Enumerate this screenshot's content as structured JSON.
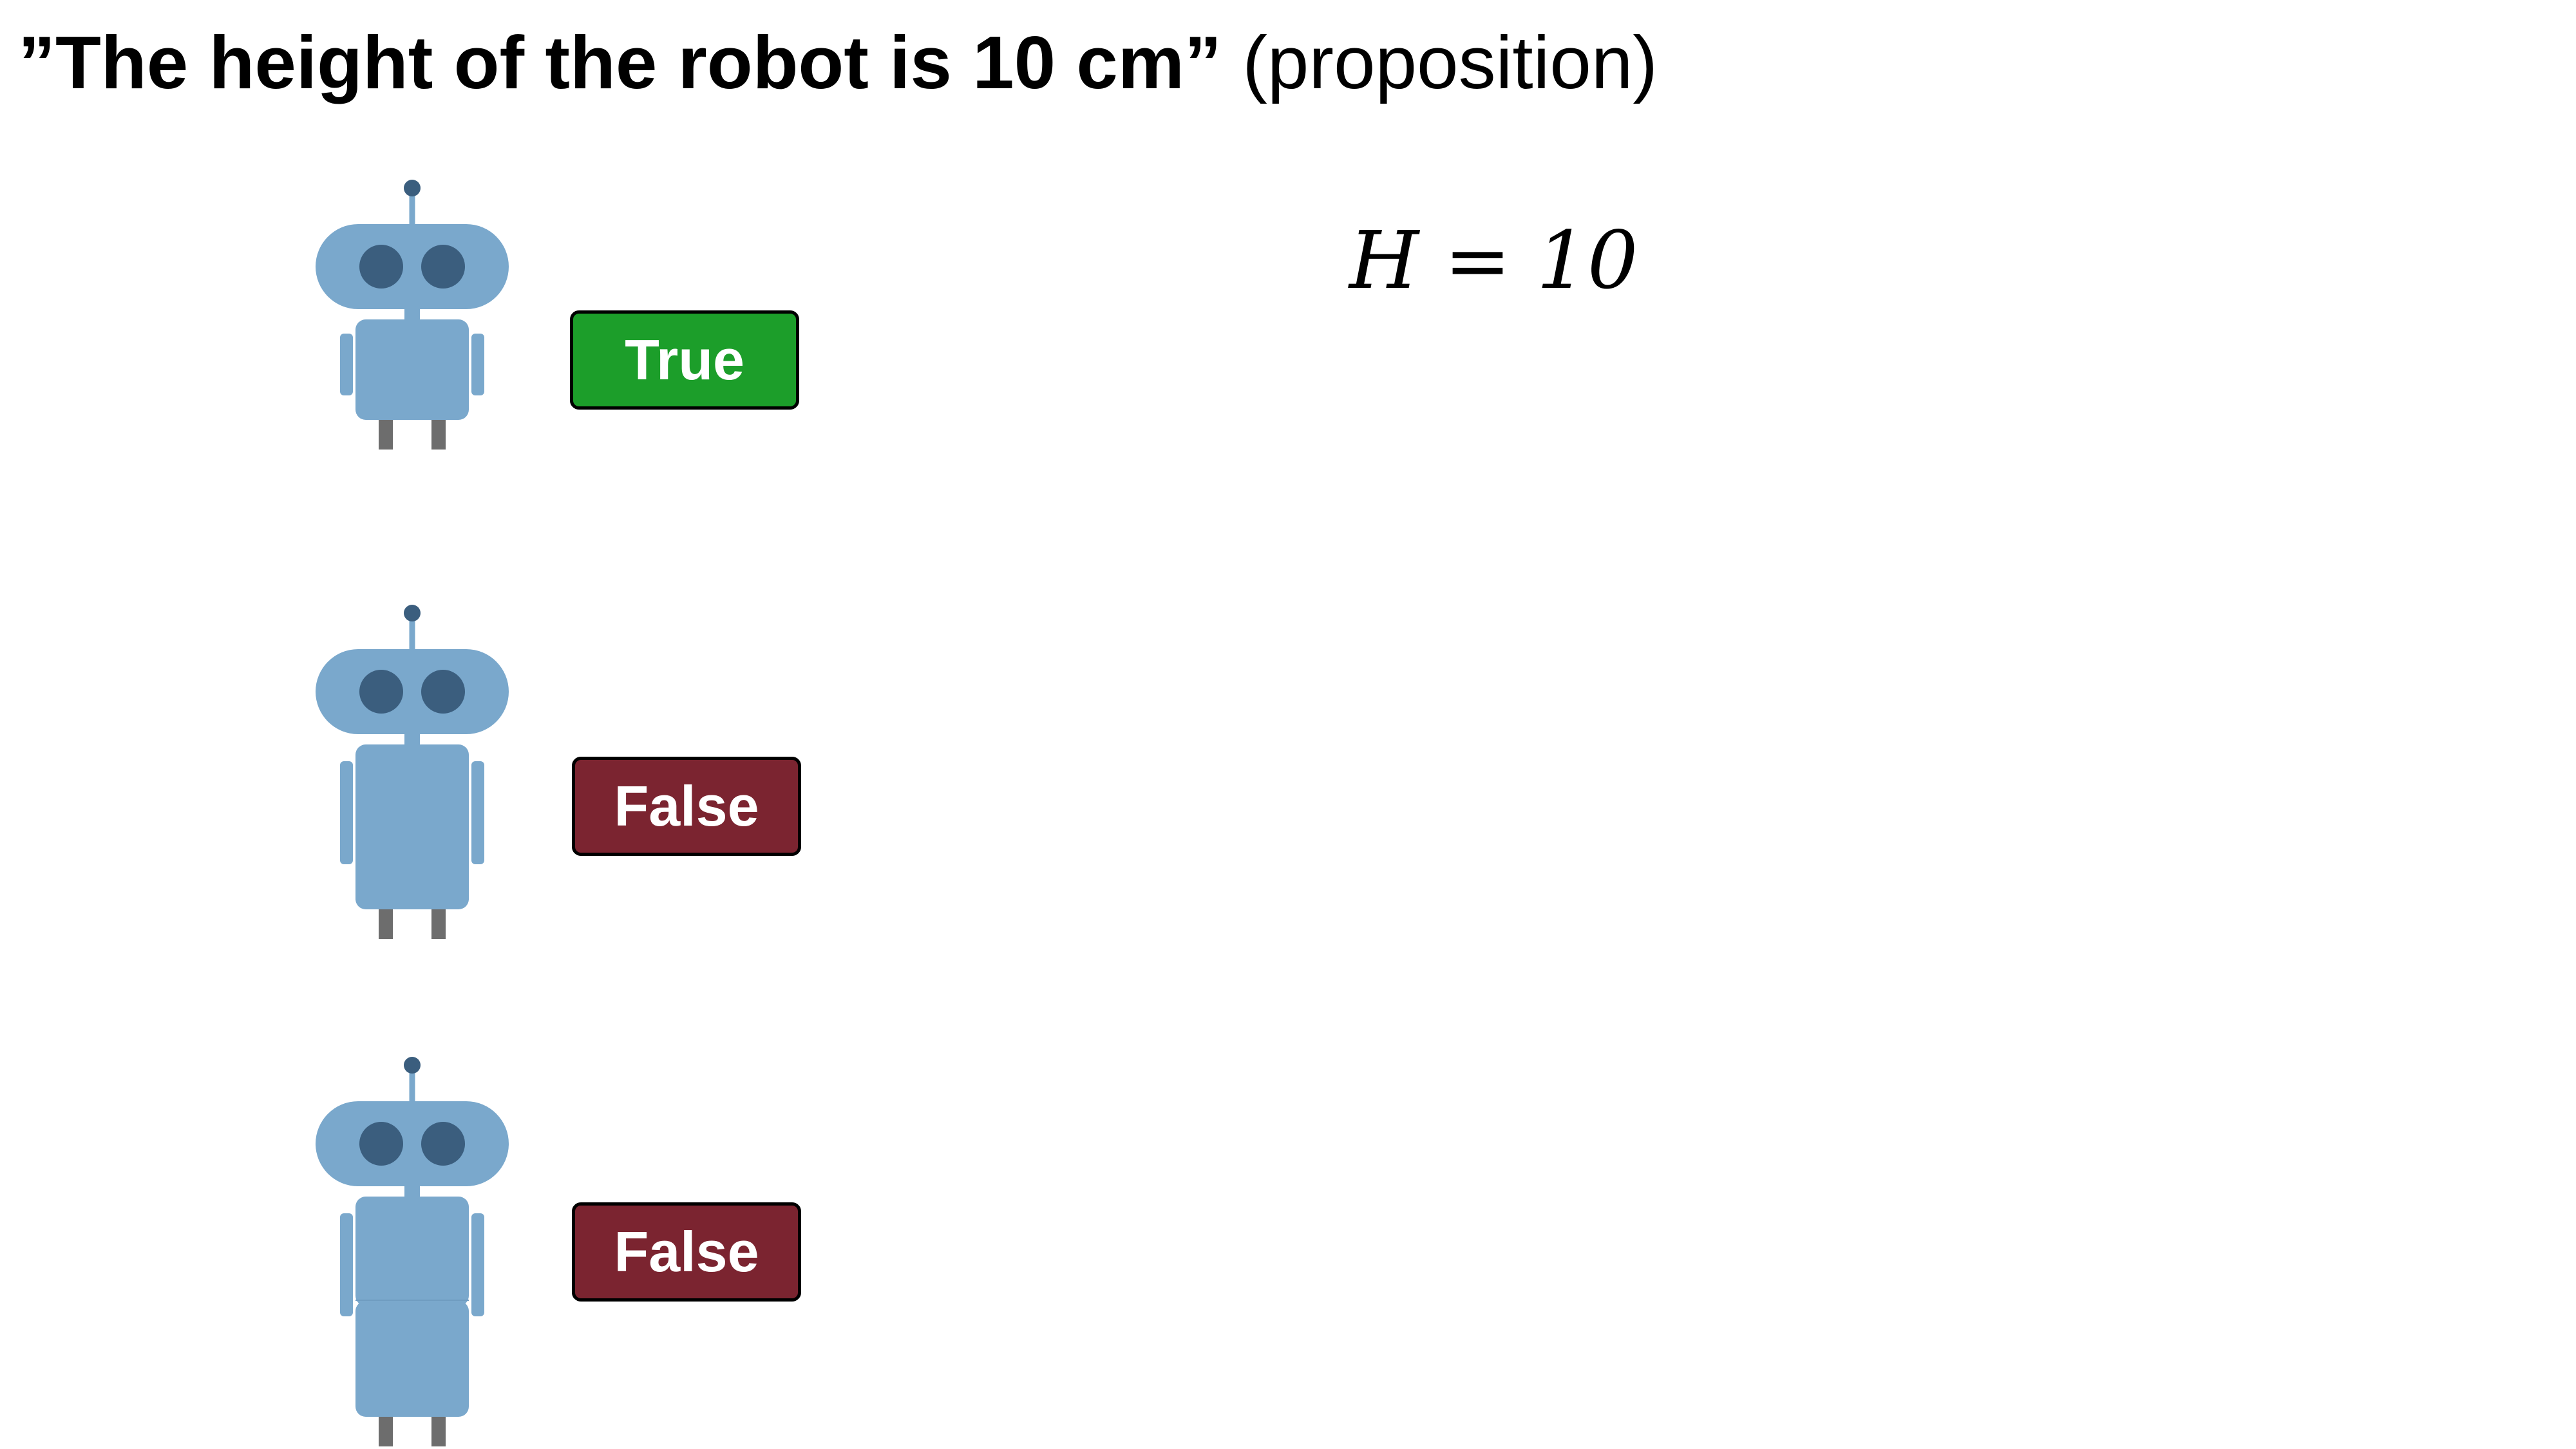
{
  "title": {
    "bold_part": "”The height of the robot is 10 cm”",
    "normal_part": " (proposition)"
  },
  "equation": {
    "text": "H = 10"
  },
  "rows": [
    {
      "label": "True",
      "color": "#1c9e2a"
    },
    {
      "label": "False",
      "color": "#7b2430"
    },
    {
      "label": "False",
      "color": "#7b2430"
    }
  ],
  "colors": {
    "robot_body": "#7aa8cc",
    "robot_eyes": "#3b5e7e",
    "robot_legs": "#6d6d6d"
  }
}
